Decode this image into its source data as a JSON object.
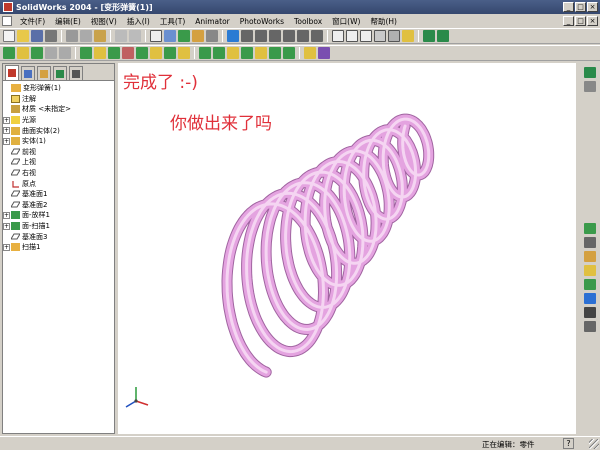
{
  "window": {
    "title": "SolidWorks 2004 - [变形弹簧(1)]",
    "controls": {
      "minimize": "_",
      "maximize": "□",
      "close": "×"
    }
  },
  "menu": {
    "items": [
      "文件(F)",
      "编辑(E)",
      "视图(V)",
      "插入(I)",
      "工具(T)",
      "Animator",
      "PhotoWorks",
      "Toolbox",
      "窗口(W)",
      "帮助(H)"
    ]
  },
  "tree": {
    "items": [
      {
        "label": "变形弹簧(1)",
        "icon": "part-icon",
        "expander": ""
      },
      {
        "label": "注解",
        "icon": "annotation-icon",
        "expander": ""
      },
      {
        "label": "材质 <未指定>",
        "icon": "material-icon",
        "expander": ""
      },
      {
        "label": "光源",
        "icon": "lights-folder-icon",
        "expander": "+"
      },
      {
        "label": "曲面实体(2)",
        "icon": "surface-bodies-icon",
        "expander": "+"
      },
      {
        "label": "实体(1)",
        "icon": "solid-bodies-icon",
        "expander": "+"
      },
      {
        "label": "前视",
        "icon": "plane-icon",
        "expander": ""
      },
      {
        "label": "上视",
        "icon": "plane-icon",
        "expander": ""
      },
      {
        "label": "右视",
        "icon": "plane-icon",
        "expander": ""
      },
      {
        "label": "原点",
        "icon": "origin-icon",
        "expander": ""
      },
      {
        "label": "基准面1",
        "icon": "plane-icon",
        "expander": ""
      },
      {
        "label": "基准面2",
        "icon": "plane-icon",
        "expander": ""
      },
      {
        "label": "面-放样1",
        "icon": "loft-surface-icon",
        "expander": "+"
      },
      {
        "label": "面-扫描1",
        "icon": "sweep-surface-icon",
        "expander": "+"
      },
      {
        "label": "基准面3",
        "icon": "plane-icon",
        "expander": ""
      },
      {
        "label": "扫描1",
        "icon": "sweep-feature-icon",
        "expander": "+"
      }
    ]
  },
  "viewport": {
    "text_done": "完成了   :-)",
    "text_question": "你做出来了吗",
    "text_color": "#e0303a",
    "spring_color": "#e4a3e0",
    "triad_labels": {
      "x": "",
      "y": "",
      "z": ""
    }
  },
  "status": {
    "editing": "正在编辑：零件",
    "help": "?"
  },
  "colors": {
    "chrome": "#d4d0c8",
    "titlebar": "#3e5178",
    "viewport_bg": "#ffffff"
  }
}
